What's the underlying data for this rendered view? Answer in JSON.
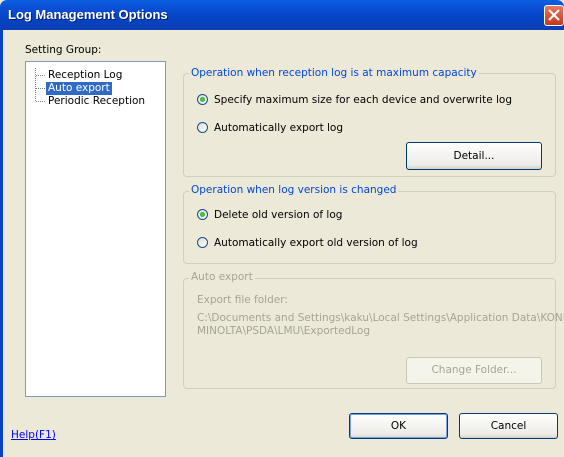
{
  "window": {
    "title": "Log Management Options"
  },
  "setting_group": {
    "label": "Setting Group:",
    "items": [
      {
        "label": "Reception Log",
        "selected": false
      },
      {
        "label": "Auto export",
        "selected": true
      },
      {
        "label": "Periodic Reception",
        "selected": false
      }
    ]
  },
  "max_capacity": {
    "legend": "Operation when reception log is at maximum capacity",
    "option1": "Specify maximum size for each device and overwrite log",
    "option2": "Automatically export log",
    "selected": 1,
    "detail_button": "Detail..."
  },
  "version_changed": {
    "legend": "Operation when log version is changed",
    "option1": "Delete old version of log",
    "option2": "Automatically export old version of log",
    "selected": 1
  },
  "auto_export": {
    "legend": "Auto export",
    "folder_label": "Export file folder:",
    "folder_line1": "C:\\Documents and Settings\\kaku\\Local Settings\\Application Data\\KONICA",
    "folder_line2": "MINOLTA\\PSDA\\LMU\\ExportedLog",
    "change_button": "Change Folder..."
  },
  "footer": {
    "help_link": "Help(F1)",
    "ok_button": "OK",
    "cancel_button": "Cancel"
  },
  "colors": {
    "titlebar": "#0a4fd6",
    "selection": "#316ac5",
    "group_legend": "#0046d5",
    "disabled": "#a5a595"
  }
}
